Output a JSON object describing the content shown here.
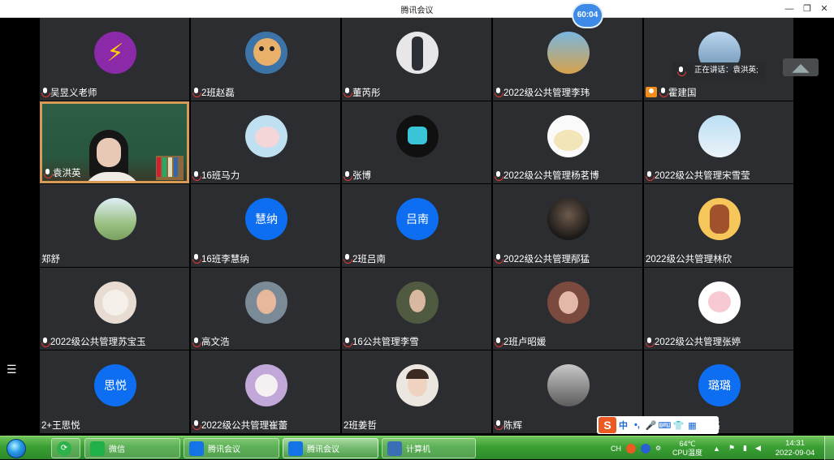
{
  "window": {
    "title": "腾讯会议",
    "timer": "60:04"
  },
  "speaking_info": "正在讲话：袁洪英;",
  "participants": [
    {
      "name": "吴昱义老师",
      "avatar": "bolt",
      "muted": true
    },
    {
      "name": "2班赵磊",
      "avatar": "cartoon",
      "muted": true
    },
    {
      "name": "董芮彤",
      "avatar": "photo-figure",
      "muted": true
    },
    {
      "name": "2022级公共管理李玮",
      "avatar": "photo-cartoon",
      "muted": true
    },
    {
      "name": "霍建国",
      "avatar": "photo-landscape",
      "muted": true,
      "host": true
    },
    {
      "name": "袁洪英",
      "avatar": "video",
      "muted": false
    },
    {
      "name": "16班马力",
      "avatar": "photo-pig",
      "muted": true
    },
    {
      "name": "张博",
      "avatar": "photo-dark",
      "muted": true
    },
    {
      "name": "2022级公共管理杨茗博",
      "avatar": "photo-bear",
      "muted": true
    },
    {
      "name": "2022级公共管理宋雪莹",
      "avatar": "photo-sky",
      "muted": true
    },
    {
      "name": "郑舒",
      "avatar": "photo-mountain",
      "muted": false,
      "nomic": true
    },
    {
      "name": "16班李慧纳",
      "avatar": "text",
      "avatar_text": "慧纳",
      "muted": true
    },
    {
      "name": "2班吕南",
      "avatar": "text",
      "avatar_text": "吕南",
      "muted": true
    },
    {
      "name": "2022级公共管理邴猛",
      "avatar": "photo-night",
      "muted": true
    },
    {
      "name": "2022级公共管理林欣",
      "avatar": "photo-horse",
      "muted": false,
      "nomic": true
    },
    {
      "name": "2022级公共管理苏宝玉",
      "avatar": "photo-cat",
      "muted": true
    },
    {
      "name": "高文浩",
      "avatar": "photo-boy",
      "muted": true
    },
    {
      "name": "16公共管理李雪",
      "avatar": "photo-woman",
      "muted": true
    },
    {
      "name": "2班卢昭媛",
      "avatar": "photo-hand",
      "muted": true
    },
    {
      "name": "2022级公共管理张婷",
      "avatar": "photo-pink",
      "muted": true
    },
    {
      "name": "2+王思悦",
      "avatar": "text",
      "avatar_text": "思悦",
      "muted": false,
      "nomic": true
    },
    {
      "name": "2022级公共管理崔蕾",
      "avatar": "photo-dog",
      "muted": true
    },
    {
      "name": "2班姜哲",
      "avatar": "photo-baby",
      "muted": false,
      "nomic": true
    },
    {
      "name": "陈辉",
      "avatar": "photo-grey",
      "muted": true
    },
    {
      "name": "公共管理向璐璐",
      "avatar": "text",
      "avatar_text": "璐璐",
      "muted": true
    }
  ],
  "ime": {
    "chinese_label": "中",
    "punct_label": "•,"
  },
  "taskbar": {
    "items": [
      {
        "label": "微信",
        "icon": "wechat-icon",
        "color": "#21b14b"
      },
      {
        "label": "腾讯会议",
        "icon": "meeting-icon",
        "color": "#1473e6"
      },
      {
        "label": "腾讯会议",
        "icon": "meeting-icon",
        "color": "#1473e6"
      },
      {
        "label": "计算机",
        "icon": "computer-icon",
        "color": "#3a6fb5"
      }
    ],
    "tray": {
      "lang": "CH",
      "temp": "64℃",
      "temp_label": "CPU温度",
      "time": "14:31",
      "date": "2022-09-04"
    }
  }
}
